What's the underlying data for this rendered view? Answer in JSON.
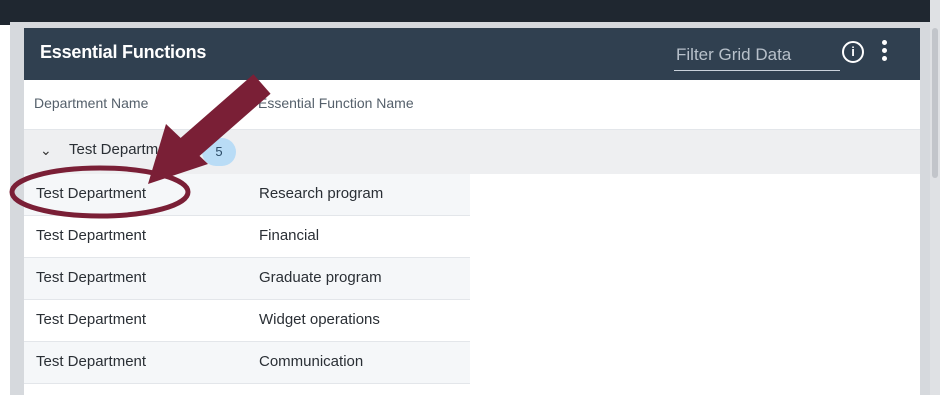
{
  "panel": {
    "title": "Essential Functions",
    "filter_placeholder": "Filter Grid Data",
    "info_glyph": "i",
    "info_icon": "info-icon",
    "more_icon": "more-vertical-icon"
  },
  "columns": {
    "department": "Department Name",
    "function": "Essential Function Name"
  },
  "group": {
    "label": "Test Department",
    "count": "5",
    "chevron": "⌄"
  },
  "rows": [
    {
      "department": "Test Department",
      "function": "Research program"
    },
    {
      "department": "Test Department",
      "function": "Financial"
    },
    {
      "department": "Test Department",
      "function": "Graduate program"
    },
    {
      "department": "Test Department",
      "function": "Widget operations"
    },
    {
      "department": "Test Department",
      "function": "Communication"
    }
  ],
  "annotation": {
    "color": "#7a1f36"
  }
}
